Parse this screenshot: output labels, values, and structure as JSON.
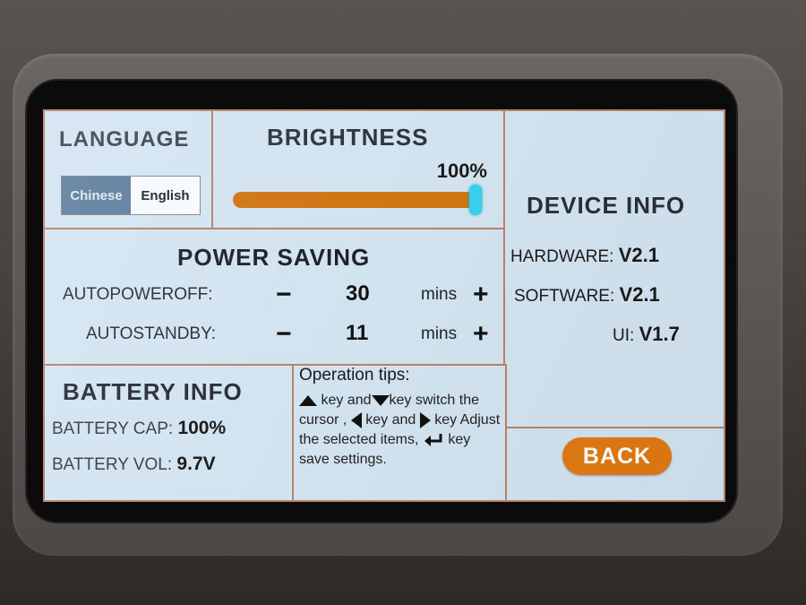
{
  "language": {
    "title": "LANGUAGE",
    "options": [
      "Chinese",
      "English"
    ],
    "selected": "Chinese"
  },
  "brightness": {
    "title": "BRIGHTNESS",
    "percent_label": "100%",
    "value": 1.0,
    "track_color": "#d07614",
    "knob_color": "#39d0f0"
  },
  "device_info": {
    "title": "DEVICE INFO",
    "hardware_label": "HARDWARE:",
    "hardware_value": "V2.1",
    "software_label": "SOFTWARE:",
    "software_value": "V2.1",
    "ui_label": "UI:",
    "ui_value": "V1.7"
  },
  "power_saving": {
    "title": "POWER SAVING",
    "auto_power_off_label": "AUTOPOWEROFF:",
    "auto_power_off_value": "30",
    "auto_standby_label": "AUTOSTANDBY:",
    "auto_standby_value": "11",
    "unit": "mins",
    "minus": "−",
    "plus": "+"
  },
  "battery_info": {
    "title": "BATTERY INFO",
    "cap_label": "BATTERY CAP:",
    "cap_value": "100%",
    "vol_label": "BATTERY VOL:",
    "vol_value": "9.7V"
  },
  "tips": {
    "title": "Operation tips:",
    "t1": "key and",
    "t2": "key switch",
    "t3": "the cursor ,",
    "t4": "key and",
    "t5": "key Adjust the selected",
    "t6": "items,",
    "t7": "key save",
    "t8": "settings.",
    "icons": [
      "up-arrow-icon",
      "down-arrow-icon",
      "left-arrow-icon",
      "right-arrow-icon",
      "enter-key-icon"
    ]
  },
  "back_button": {
    "label": "BACK",
    "color": "#e07a12"
  }
}
